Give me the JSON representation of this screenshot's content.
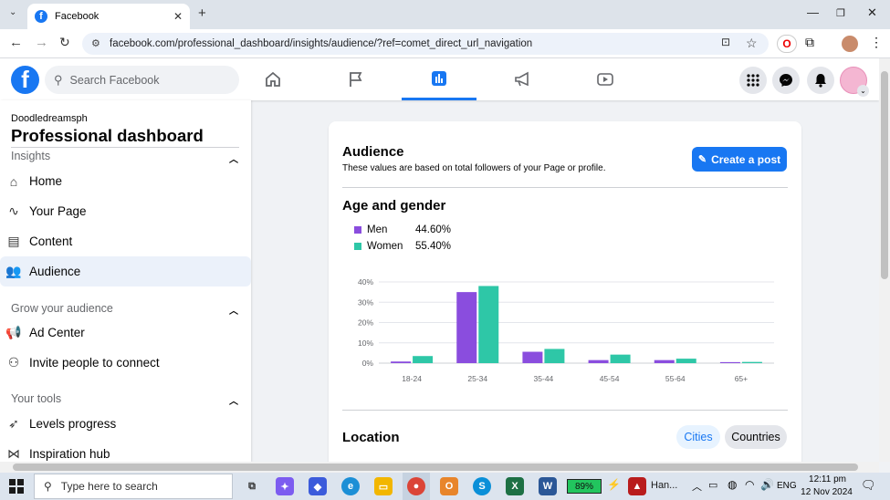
{
  "browser": {
    "tab_title": "Facebook",
    "tab_close": "✕",
    "new_tab": "+",
    "url": "facebook.com/professional_dashboard/insights/audience/?ref=comet_direct_url_navigation"
  },
  "header": {
    "logo_letter": "f",
    "search_placeholder": "Search Facebook"
  },
  "sidebar": {
    "page_name": "Doodledreamsph",
    "title": "Professional dashboard",
    "insights_label": "Insights",
    "items_insights": [
      {
        "label": "Home",
        "icon": "home-icon"
      },
      {
        "label": "Your Page",
        "icon": "trend-icon"
      },
      {
        "label": "Content",
        "icon": "content-icon"
      },
      {
        "label": "Audience",
        "icon": "people-icon"
      }
    ],
    "grow_label": "Grow your audience",
    "items_grow": [
      {
        "label": "Ad Center",
        "icon": "megaphone-icon"
      },
      {
        "label": "Invite people to connect",
        "icon": "invite-icon"
      }
    ],
    "tools_label": "Your tools",
    "items_tools": [
      {
        "label": "Levels progress",
        "icon": "rocket-icon"
      },
      {
        "label": "Inspiration hub",
        "icon": "bow-icon"
      }
    ]
  },
  "card": {
    "title": "Audience",
    "subtitle": "These values are based on total followers of your Page or profile.",
    "create_post": "Create a post",
    "age_gender_title": "Age and gender",
    "legend": [
      {
        "name": "Men",
        "value": "44.60%",
        "color": "#8a4dde"
      },
      {
        "name": "Women",
        "value": "55.40%",
        "color": "#2ec7a7"
      }
    ],
    "location_title": "Location",
    "cities": "Cities",
    "countries": "Countries"
  },
  "chart_data": {
    "type": "bar",
    "categories": [
      "18-24",
      "25-34",
      "35-44",
      "45-54",
      "55-64",
      "65+"
    ],
    "series": [
      {
        "name": "Men",
        "values": [
          0.8,
          35.0,
          5.6,
          1.5,
          1.5,
          0.5
        ]
      },
      {
        "name": "Women",
        "values": [
          3.5,
          38.0,
          7.0,
          4.2,
          2.2,
          0.6
        ]
      }
    ],
    "yticks": [
      "0%",
      "10%",
      "20%",
      "30%",
      "40%"
    ],
    "ylim": [
      0,
      40
    ],
    "grid": true
  },
  "taskbar": {
    "search_placeholder": "Type here to search",
    "battery": "89%",
    "app_label": "Han...",
    "lang": "ENG",
    "time": "12:11 pm",
    "date": "12 Nov 2024"
  }
}
